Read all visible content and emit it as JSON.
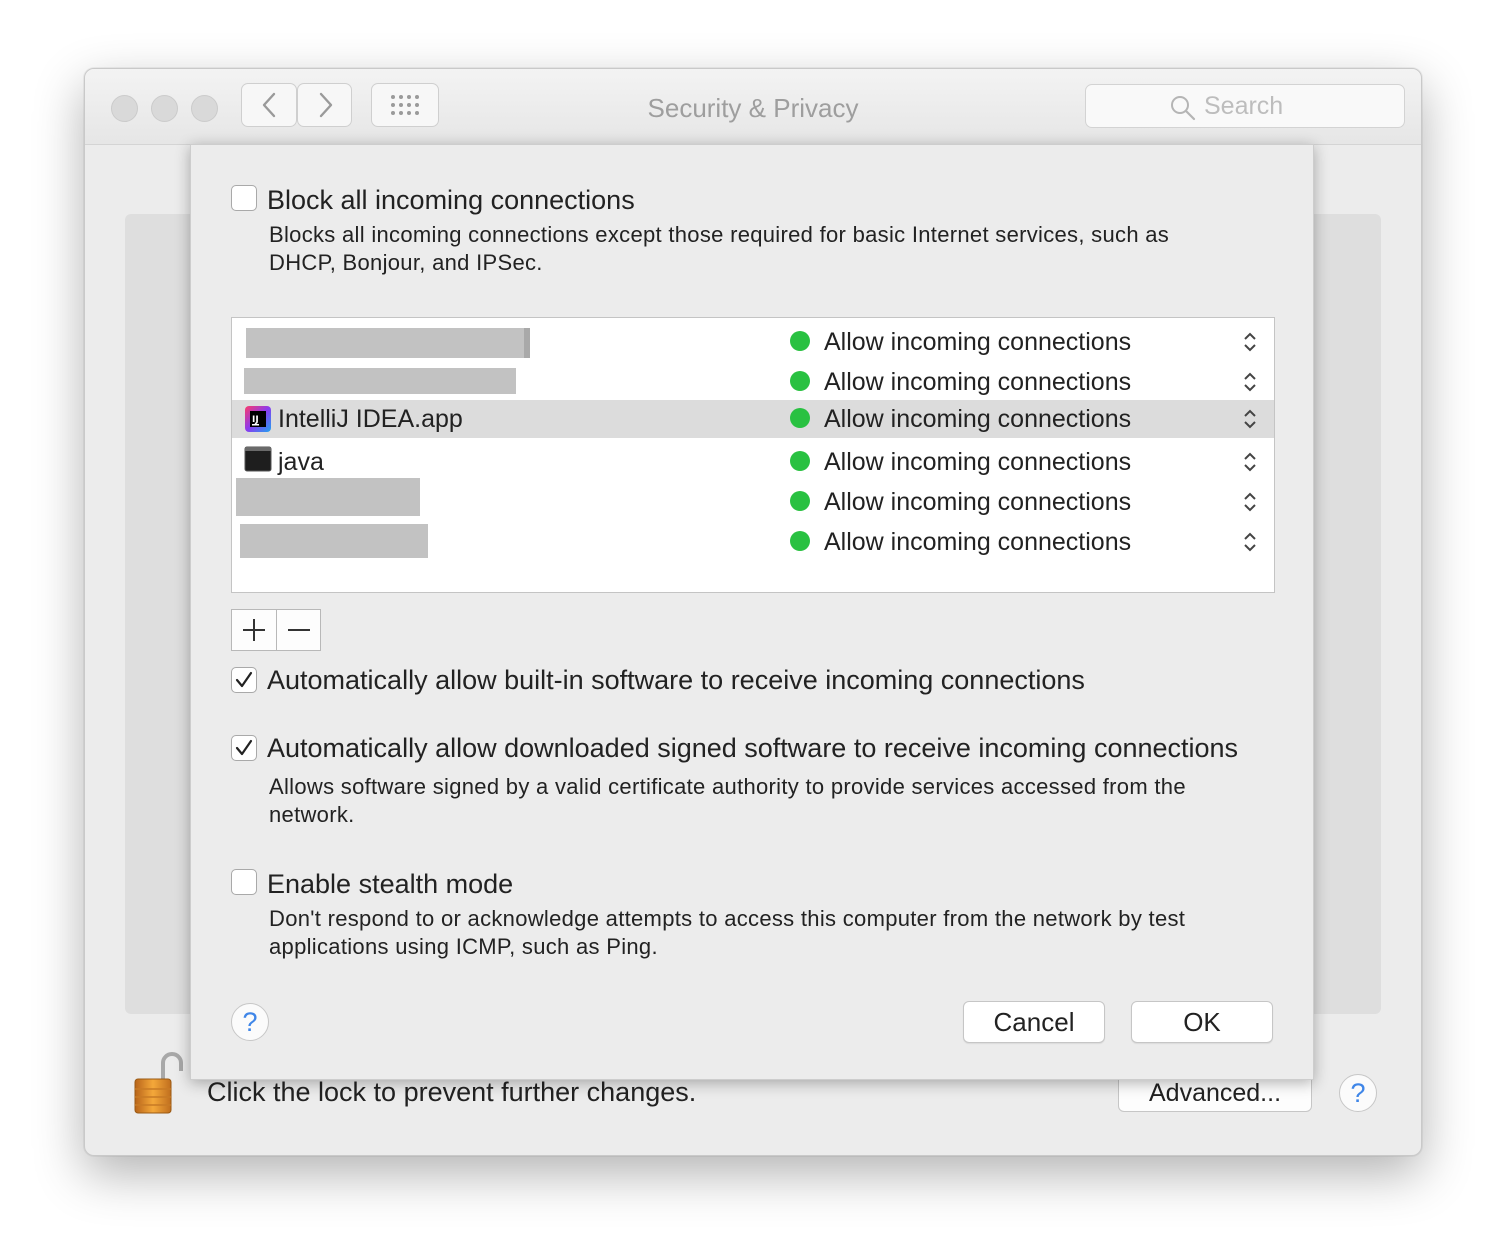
{
  "window": {
    "title": "Security & Privacy",
    "search_placeholder": "Search"
  },
  "background": {
    "lock_text": "Click the lock to prevent further changes.",
    "advanced_label": "Advanced...",
    "help_label": "?"
  },
  "firewall": {
    "block_all": {
      "label": "Block all incoming connections",
      "checked": false,
      "description_line1": "Blocks all incoming connections except those required for basic Internet services,  such as",
      "description_line2": "DHCP, Bonjour, and IPSec."
    },
    "apps": [
      {
        "name": "",
        "status": "Allow incoming connections",
        "redacted": true
      },
      {
        "name": "",
        "status": "Allow incoming connections",
        "redacted": true
      },
      {
        "name": "IntelliJ IDEA.app",
        "status": "Allow incoming connections",
        "selected": true
      },
      {
        "name": "java",
        "status": "Allow incoming connections"
      },
      {
        "name": "",
        "status": "Allow incoming connections",
        "redacted": true
      },
      {
        "name": "",
        "status": "Allow incoming connections",
        "redacted": true
      }
    ],
    "status_color": "#29c141",
    "add_label": "+",
    "remove_label": "−",
    "auto_builtin": {
      "label": "Automatically allow built-in software to receive incoming connections",
      "checked": true
    },
    "auto_signed": {
      "label": "Automatically allow downloaded signed software to receive incoming connections",
      "checked": true,
      "description_line1": "Allows software signed by a valid certificate authority to provide services accessed from the",
      "description_line2": "network."
    },
    "stealth": {
      "label": "Enable stealth mode",
      "checked": false,
      "description_line1": "Don't respond to or acknowledge attempts to access this computer from the network by test",
      "description_line2": "applications using ICMP, such as Ping."
    },
    "help_label": "?",
    "cancel_label": "Cancel",
    "ok_label": "OK"
  }
}
